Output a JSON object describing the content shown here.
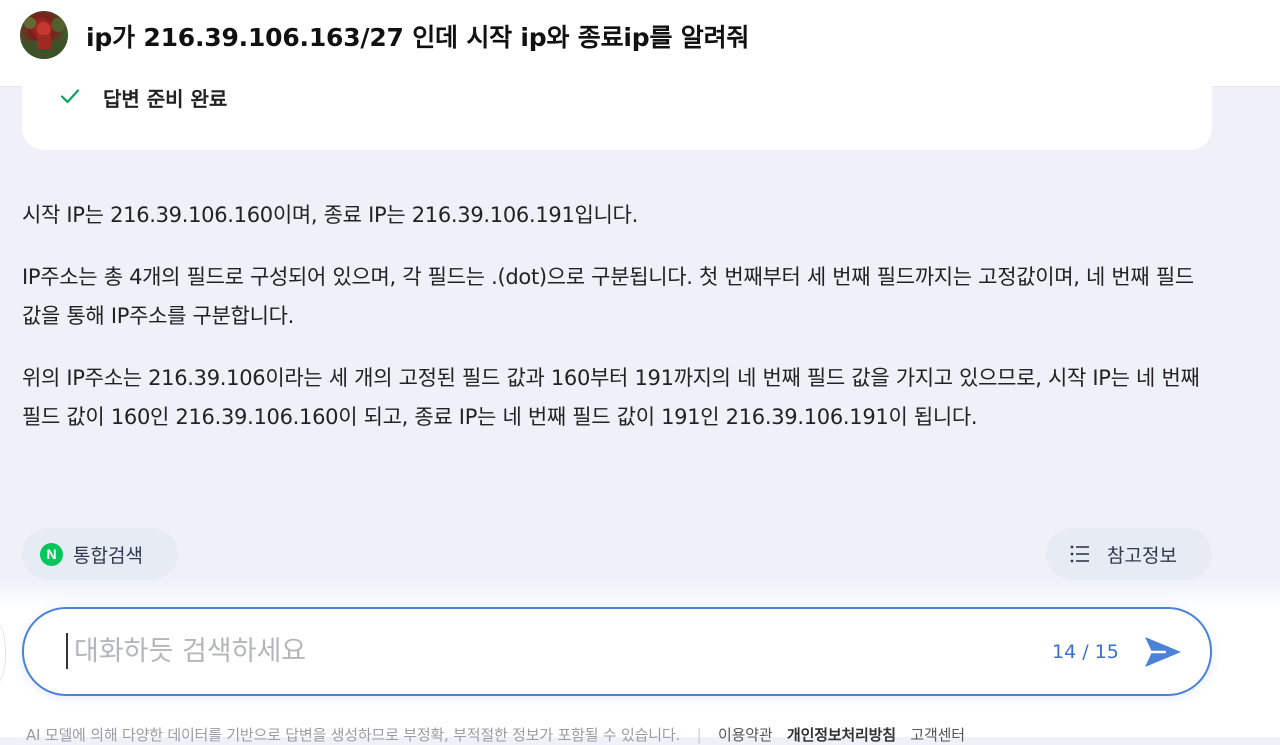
{
  "header": {
    "title": "ip가 216.39.106.163/27 인데 시작 ip와 종료ip를 알려줘",
    "avatar_icon": "user-avatar"
  },
  "status": {
    "text": "답변 준비 완료",
    "icon": "check-icon",
    "color": "#03a65a"
  },
  "answer": {
    "paragraphs": [
      "시작 IP는 216.39.106.160이며, 종료 IP는 216.39.106.191입니다.",
      "IP주소는 총 4개의 필드로 구성되어 있으며, 각 필드는 .(dot)으로 구분됩니다. 첫 번째부터 세 번째 필드까지는 고정값이며, 네 번째 필드 값을 통해 IP주소를 구분합니다.",
      "위의 IP주소는 216.39.106이라는 세 개의 고정된 필드 값과 160부터 191까지의 네 번째 필드 값을 가지고 있으므로, 시작 IP는 네 번째 필드 값이 160인 216.39.106.160이 되고, 종료 IP는 네 번째 필드 값이 191인 216.39.106.191이 됩니다."
    ]
  },
  "actions": {
    "search_label": "통합검색",
    "search_badge": "N",
    "refs_label": "참고정보"
  },
  "input": {
    "placeholder": "대화하듯 검색하세요",
    "value": "",
    "char_count": "14 / 15",
    "accent_color": "#4a82d8"
  },
  "footer": {
    "disclaimer": "AI 모델에 의해 다양한 데이터를 기반으로 답변을 생성하므로 부정확, 부적절한 정보가 포함될 수 있습니다.",
    "terms_label": "이용약관",
    "privacy_label": "개인정보처리방침",
    "support_label": "고객센터"
  }
}
